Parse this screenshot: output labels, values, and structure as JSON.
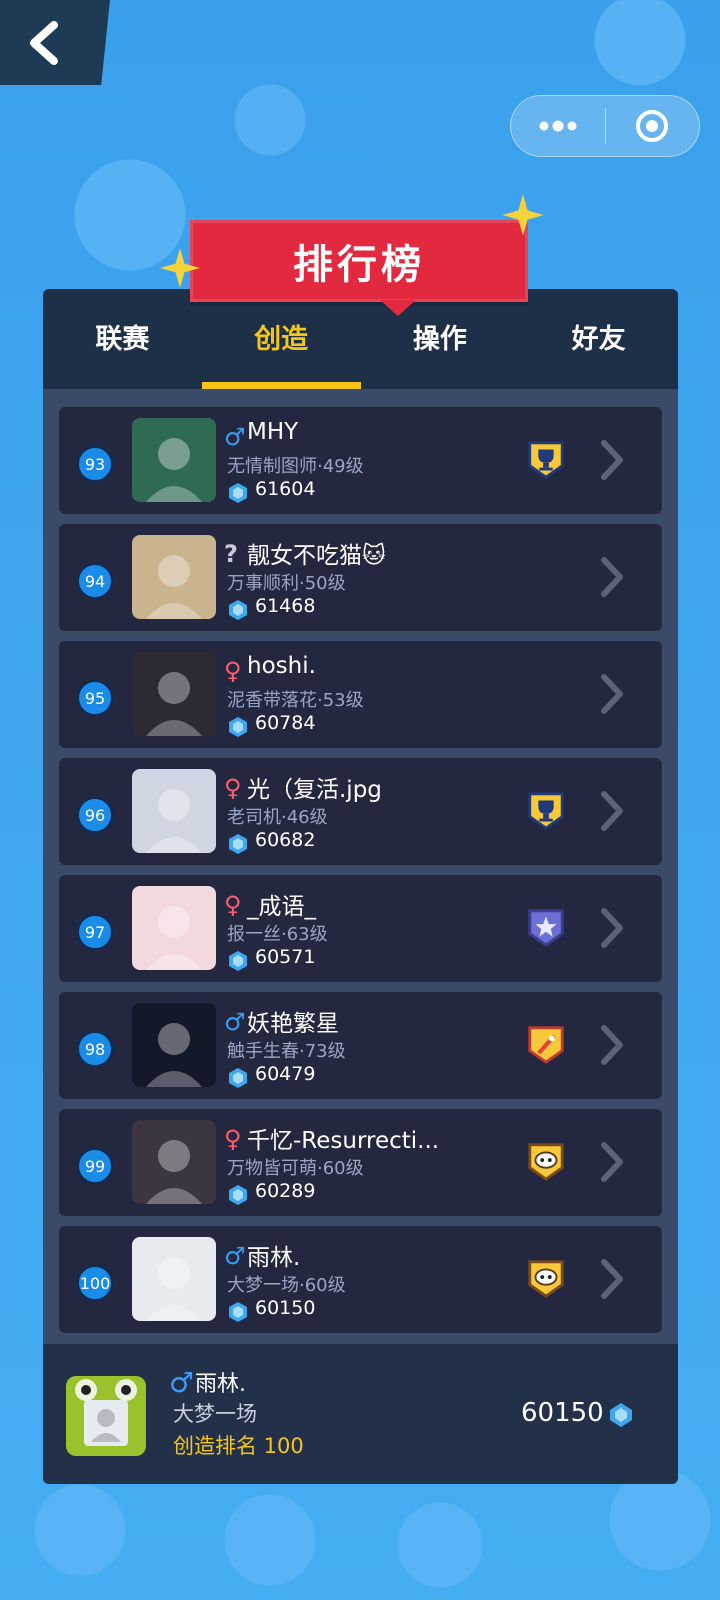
{
  "header": {
    "back_icon": "chevron-left-icon",
    "capsule": {
      "more_icon": "more-dots-icon",
      "target_icon": "target-icon"
    }
  },
  "title": "排行榜",
  "tabs": [
    {
      "label": "联赛",
      "active": false
    },
    {
      "label": "创造",
      "active": true
    },
    {
      "label": "操作",
      "active": false
    },
    {
      "label": "好友",
      "active": false
    }
  ],
  "entries": [
    {
      "rank": "93",
      "gender": "♂",
      "gender_type": "male",
      "name": "MHY",
      "title": "无情制图师·49级",
      "score": "61604",
      "badge": "trophy-badge-icon",
      "avatar_color": "#2f6a52"
    },
    {
      "rank": "94",
      "gender": "?",
      "gender_type": "unknown",
      "name": "靓女不吃猫🐱",
      "title": "万事顺利·50级",
      "score": "61468",
      "badge": "",
      "avatar_color": "#c9b48e"
    },
    {
      "rank": "95",
      "gender": "♀",
      "gender_type": "female",
      "name": "hoshi.",
      "title": "泥香带落花·53级",
      "score": "60784",
      "badge": "",
      "avatar_color": "#2c2a33"
    },
    {
      "rank": "96",
      "gender": "♀",
      "gender_type": "female",
      "name": "光（复活.jpg",
      "title": "老司机·46级",
      "score": "60682",
      "badge": "trophy-badge-icon",
      "avatar_color": "#cfd6e2"
    },
    {
      "rank": "97",
      "gender": "♀",
      "gender_type": "female",
      "name": "_成语_",
      "title": "报一丝·63级",
      "score": "60571",
      "badge": "star-badge-icon",
      "avatar_color": "#f3d9dd"
    },
    {
      "rank": "98",
      "gender": "♂",
      "gender_type": "male",
      "name": "妖艳繁星",
      "title": "触手生春·73级",
      "score": "60479",
      "badge": "rocket-badge-icon",
      "avatar_color": "#14192a"
    },
    {
      "rank": "99",
      "gender": "♀",
      "gender_type": "female",
      "name": "千忆-Resurrecti...",
      "title": "万物皆可萌·60级",
      "score": "60289",
      "badge": "sheep-badge-icon",
      "avatar_color": "#3d3540"
    },
    {
      "rank": "100",
      "gender": "♂",
      "gender_type": "male",
      "name": "雨林.",
      "title": "大梦一场·60级",
      "score": "60150",
      "badge": "sheep-badge-icon",
      "avatar_color": "#e6ebf0"
    }
  ],
  "self": {
    "gender": "♂",
    "name": "雨林.",
    "title": "大梦一场",
    "rank_text": "创造排名 100",
    "score": "60150"
  },
  "colors": {
    "accent": "#f5c518",
    "ribbon": "#e2293f",
    "rank_bubble": "#1a8ce8",
    "male": "#3c9bf2",
    "female": "#ff5b6e"
  }
}
